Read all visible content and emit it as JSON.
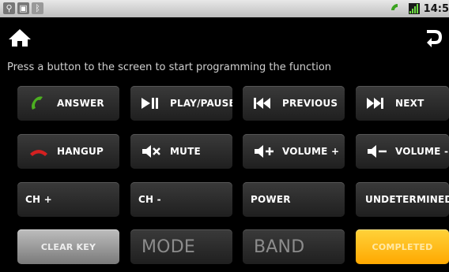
{
  "statusbar": {
    "left_icons": [
      "usb-icon",
      "android-debug-icon",
      "bluetooth-icon"
    ],
    "right_icons": [
      "wifi-icon",
      "signal-icon"
    ],
    "clock": "14:5"
  },
  "header": {
    "home_icon": "home-icon",
    "back_icon": "back-icon"
  },
  "instruction": "Press a button to the screen to start programming the function",
  "buttons": {
    "answer": "ANSWER",
    "play_pause": "PLAY/PAUSE",
    "previous": "PREVIOUS",
    "next": "NEXT",
    "hangup": "HANGUP",
    "mute": "MUTE",
    "volume_up": "VOLUME +",
    "volume_down": "VOLUME -",
    "ch_plus": "CH +",
    "ch_minus": "CH -",
    "power": "POWER",
    "undetermined": "UNDETERMINED",
    "clear_key": "CLEAR KEY",
    "mode": "MODE",
    "band": "BAND",
    "completed": "COMPLETED"
  },
  "colors": {
    "answer_icon": "#4caf20",
    "hangup_icon": "#d42020",
    "completed_bg": "#ffb300",
    "clear_bg": "#a0a0a0"
  }
}
